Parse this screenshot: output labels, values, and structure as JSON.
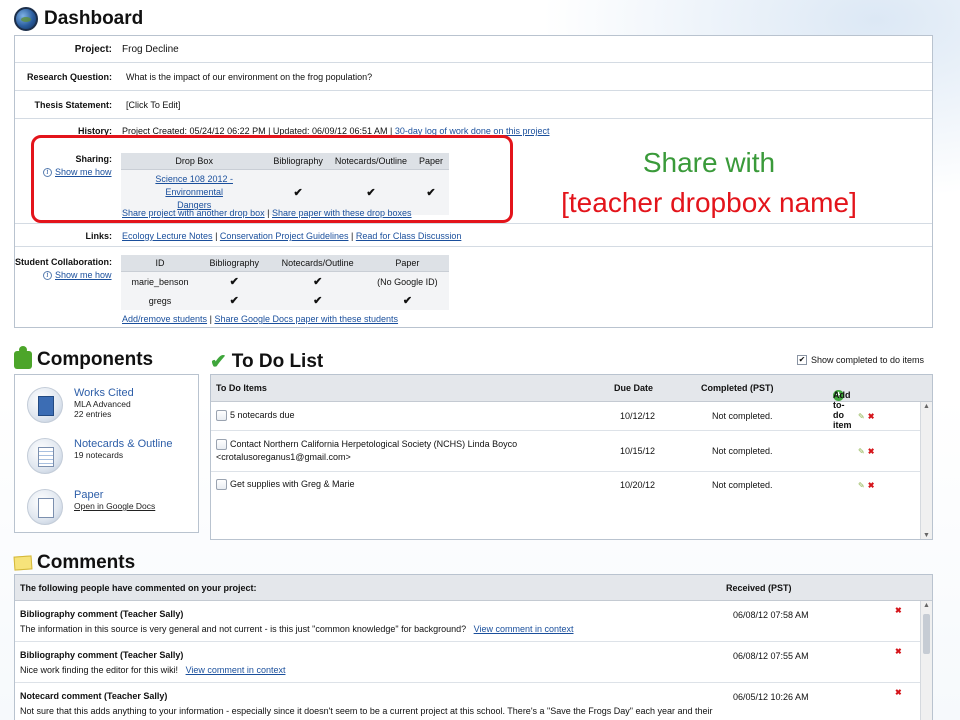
{
  "header": {
    "title": "Dashboard"
  },
  "project": {
    "project_label": "Project:",
    "project_value": "Frog Decline",
    "rq_label": "Research Question:",
    "rq_value": "What is the impact of our environment on the frog population?",
    "thesis_label": "Thesis Statement:",
    "thesis_value": "[Click To Edit]",
    "history_label": "History:",
    "history_value": "Project Created: 05/24/12 06:22 PM | Updated: 06/09/12 06:51 AM |",
    "history_link": "30-day log of work done on this project",
    "sharing_label": "Sharing:",
    "show_me_how": "Show me how",
    "sharing_table": {
      "headers": [
        "Drop Box",
        "Bibliography",
        "Notecards/Outline",
        "Paper"
      ],
      "dropbox_line1": "Science 108 2012 - Environmental",
      "dropbox_line2": "Dangers"
    },
    "share_link_1": "Share project with another drop box",
    "share_sep": "|",
    "share_link_2": "Share paper with these drop boxes",
    "links_label": "Links:",
    "links": [
      "Ecology Lecture Notes",
      "Conservation Project Guidelines",
      "Read for Class Discussion"
    ],
    "collab_label": "Student Collaboration:",
    "collab_table": {
      "headers": [
        "ID",
        "Bibliography",
        "Notecards/Outline",
        "Paper"
      ],
      "rows": [
        {
          "id": "marie_benson",
          "paper": "(No Google ID)"
        },
        {
          "id": "gregs",
          "paper": ""
        }
      ]
    },
    "collab_link_1": "Add/remove students",
    "collab_link_2": "Share Google Docs paper with these students"
  },
  "callout": {
    "line1": "Share with",
    "line2": "[teacher dropbox name]"
  },
  "components": {
    "title": "Components",
    "items": [
      {
        "title": "Works Cited",
        "sub1": "MLA Advanced",
        "sub2": "22 entries"
      },
      {
        "title": "Notecards & Outline",
        "sub1": "19 notecards",
        "sub2": ""
      },
      {
        "title": "Paper",
        "sub1": "Open in Google Docs",
        "sub2": ""
      }
    ]
  },
  "todo": {
    "title": "To Do List",
    "show_completed": "Show completed to do items",
    "headers": {
      "items": "To Do Items",
      "due": "Due Date",
      "completed": "Completed (PST)",
      "add": "Add to-do item"
    },
    "rows": [
      {
        "text1": "5 notecards due",
        "text2": "",
        "due": "10/12/12",
        "status": "Not completed."
      },
      {
        "text1": "Contact Northern California Herpetological Society (NCHS) Linda Boyco",
        "text2": "<crotalusoreganus1@gmail.com>",
        "due": "10/15/12",
        "status": "Not completed."
      },
      {
        "text1": "Get supplies with Greg & Marie",
        "text2": "",
        "due": "10/20/12",
        "status": "Not completed."
      }
    ]
  },
  "comments": {
    "title": "Comments",
    "header_text": "The following people have commented on your project:",
    "header_received": "Received (PST)",
    "view_link": "View comment in context",
    "rows": [
      {
        "title": "Bibliography comment (Teacher Sally)",
        "text": "The information in this source is very general and not current - is this just \"common knowledge\" for background?",
        "date": "06/08/12 07:58 AM",
        "has_link": true
      },
      {
        "title": "Bibliography comment (Teacher Sally)",
        "text": "Nice work finding the editor for this wiki!",
        "date": "06/08/12 07:55 AM",
        "has_link": true
      },
      {
        "title": "Notecard comment (Teacher Sally)",
        "text": "Not sure that this adds anything to your information - especially since it doesn't seem to be a current project at this school. There's a \"Save the Frogs Day\" each year and their",
        "date": "06/05/12 10:26 AM",
        "has_link": false
      }
    ]
  },
  "colors": {
    "accent": "#1a4f9c",
    "highlight_red": "#e3141b",
    "callout_green": "#3a9a3a"
  }
}
